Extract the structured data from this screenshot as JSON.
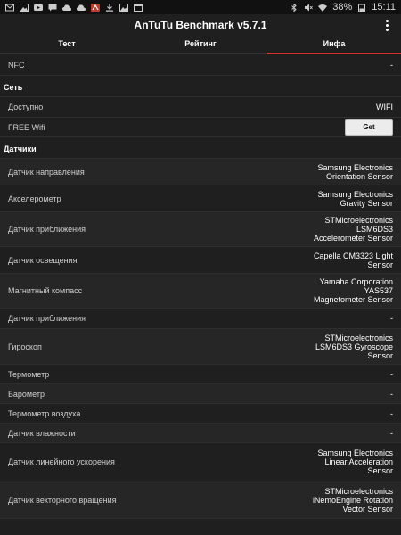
{
  "status": {
    "battery": "38%",
    "time": "15:11"
  },
  "app": {
    "title": "AnTuTu Benchmark v5.7.1"
  },
  "tabs": [
    {
      "label": "Тест"
    },
    {
      "label": "Рейтинг"
    },
    {
      "label": "Инфа"
    }
  ],
  "nfc": {
    "label": "NFC",
    "value": "-"
  },
  "network": {
    "section": "Сеть",
    "available_label": "Доступно",
    "available_value": "WIFI",
    "free_wifi_label": "FREE Wifi",
    "get_button": "Get"
  },
  "sensors": {
    "section": "Датчики",
    "items": [
      {
        "label": "Датчик направления",
        "value": [
          "Samsung Electronics",
          "Orientation Sensor"
        ]
      },
      {
        "label": "Акселерометр",
        "value": [
          "Samsung Electronics",
          "Gravity Sensor"
        ]
      },
      {
        "label": "Датчик приближения",
        "value": [
          "STMicroelectronics",
          "LSM6DS3",
          "Accelerometer Sensor"
        ]
      },
      {
        "label": "Датчик освещения",
        "value": [
          "Capella CM3323 Light",
          "Sensor"
        ]
      },
      {
        "label": "Магнитный компасс",
        "value": [
          "Yamaha Corporation",
          "YAS537",
          "Magnetometer Sensor"
        ]
      },
      {
        "label": "Датчик приближения",
        "value": [
          "-"
        ]
      },
      {
        "label": "Гироскоп",
        "value": [
          "STMicroelectronics",
          "LSM6DS3 Gyroscope",
          "Sensor"
        ]
      },
      {
        "label": "Термометр",
        "value": [
          "-"
        ]
      },
      {
        "label": "Барометр",
        "value": [
          "-"
        ]
      },
      {
        "label": "Термометр воздуха",
        "value": [
          "-"
        ]
      },
      {
        "label": "Датчик влажности",
        "value": [
          "-"
        ]
      },
      {
        "label": "Датчик линейного ускорения",
        "value": [
          "Samsung Electronics",
          "Linear Acceleration",
          "Sensor"
        ]
      },
      {
        "label": "Датчик векторного вращения",
        "value": [
          "STMicroelectronics",
          "iNemoEngine Rotation",
          "Vector Sensor"
        ]
      }
    ]
  }
}
